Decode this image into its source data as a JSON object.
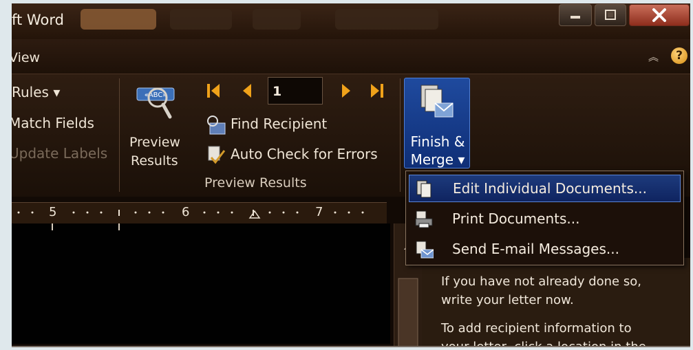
{
  "window": {
    "title": "ft Word",
    "controls": {
      "minimize": "—",
      "maximize": "□",
      "close": "X"
    }
  },
  "ribbon_tabs": {
    "current_tab_label": "View",
    "help": "?"
  },
  "ribbon": {
    "write_insert": {
      "rules_label": "Rules ▾",
      "match_fields_label": "Match Fields",
      "update_labels_label": "Update Labels"
    },
    "preview_results": {
      "preview_button_line1": "Preview",
      "preview_button_line2": "Results",
      "record_number": "1",
      "find_recipient_label": "Find Recipient",
      "auto_check_label": "Auto Check for Errors",
      "group_label": "Preview Results"
    },
    "finish": {
      "button_line1": "Finish &",
      "button_line2": "Merge ▾"
    }
  },
  "ruler": {
    "numbers": [
      "5",
      "6",
      "7"
    ]
  },
  "finish_merge_menu": {
    "items": [
      {
        "label": "Edit Individual Documents...",
        "icon": "edit-documents-icon"
      },
      {
        "label": "Print Documents...",
        "icon": "printer-icon"
      },
      {
        "label": "Send E-mail Messages...",
        "icon": "email-icon"
      }
    ]
  },
  "task_pane": {
    "line1": "If you have not already done so,",
    "line2": "write your letter now.",
    "line3": "To add recipient information to",
    "line4": "your letter, click a location in the"
  },
  "colors": {
    "ribbon_bg": "#2e1d11",
    "highlight_blue": "#1f4a9e",
    "text": "#efe5d6"
  }
}
